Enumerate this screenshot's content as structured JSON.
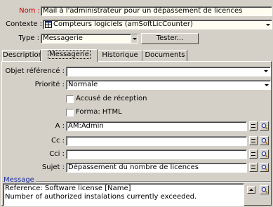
{
  "header": {
    "name_label": "Nom :",
    "name_value": "Mail à l'administrateur pour un dépassement de licences",
    "context_label": "Contexte :",
    "context_value": "Compteurs logiciels (amSoftLicCounter)",
    "type_label": "Type :",
    "type_value": "Messagerie",
    "test_button": "Tester..."
  },
  "tabs": [
    {
      "label": "Description",
      "active": false
    },
    {
      "label": "Messagerie",
      "active": true
    },
    {
      "label": "Historique",
      "active": false
    },
    {
      "label": "Documents",
      "active": false
    }
  ],
  "form": {
    "ref_object_label": "Objet référencé :",
    "ref_object_value": "",
    "priority_label": "Priorité :",
    "priority_value": "Normale",
    "receipt_label": "Accusé de réception",
    "receipt_checked": false,
    "html_label": "Forma: HTML",
    "html_checked": false,
    "to_label": "A :",
    "to_value": "AM:Admin",
    "cc_label": "Cc :",
    "cc_value": "",
    "bcc_label": "Cci :",
    "bcc_value": "",
    "subject_label": "Sujet :",
    "subject_value": "Dépassement du nombre de licences",
    "message_label": "Message",
    "message_lines": [
      "Reference: Software license [Name]",
      "Number of authorized instalations currently exceeded."
    ]
  },
  "colors": {
    "window_bg": "#d4d0c8",
    "required_label": "#cc0000",
    "group_label": "#1f2f9f"
  }
}
